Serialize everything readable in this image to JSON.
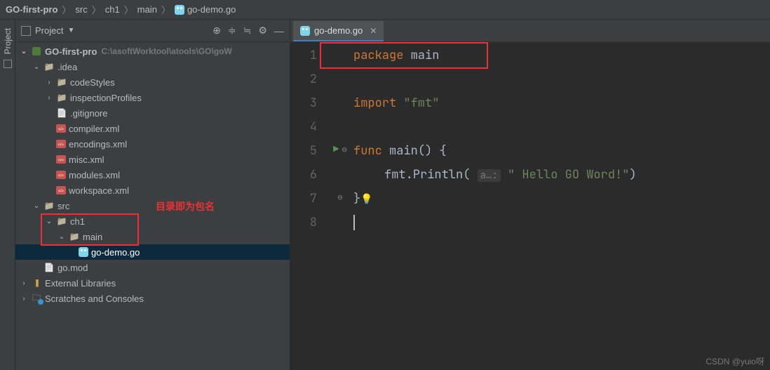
{
  "breadcrumb": [
    "GO-first-pro",
    "src",
    "ch1",
    "main",
    "go-demo.go"
  ],
  "sidebar": {
    "project_tab": "Project"
  },
  "project": {
    "title": "Project",
    "root": {
      "name": "GO-first-pro",
      "path": "C:\\asoftWorktool\\atools\\GO\\goW"
    },
    "idea_dir": ".idea",
    "idea_children": {
      "codeStyles": "codeStyles",
      "inspectionProfiles": "inspectionProfiles",
      "gitignore": ".gitignore",
      "compiler": "compiler.xml",
      "encodings": "encodings.xml",
      "misc": "misc.xml",
      "modules": "modules.xml",
      "workspace": "workspace.xml"
    },
    "src": "src",
    "ch1": "ch1",
    "main": "main",
    "gofile": "go-demo.go",
    "gomod": "go.mod",
    "ext_lib": "External Libraries",
    "scratches": "Scratches and Consoles"
  },
  "annotations": {
    "redtext": "目录即为包名"
  },
  "tabs": {
    "active": "go-demo.go"
  },
  "code": {
    "lines": [
      "1",
      "2",
      "3",
      "4",
      "5",
      "6",
      "7",
      "8"
    ],
    "package_kw": "package",
    "package_name": "main",
    "import_kw": "import",
    "import_val": "\"fmt\"",
    "func_kw": "func",
    "func_name": "main",
    "func_sig": "() {",
    "print_call": "fmt.Println(",
    "param_hint": "a…:",
    "print_str": " \" Hello GO Word!\"",
    "print_close": ")",
    "close_brace": "}"
  },
  "watermark": "CSDN @yuio呀"
}
